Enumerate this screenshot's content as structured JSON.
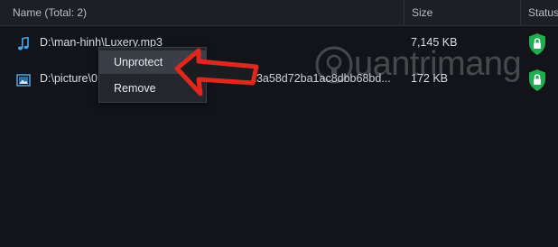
{
  "header": {
    "name_col": "Name (Total: 2)",
    "size_col": "Size",
    "status_col": "Status"
  },
  "files": [
    {
      "name": "D:\\man-hinh\\Luxery.mp3",
      "name_tail": "",
      "size": "7,145 KB",
      "icon": "music-file-icon",
      "status": "protected"
    },
    {
      "name": "D:\\picture\\0",
      "name_tail": "ff6c738c23a58d72ba1ac8dbb68bd...",
      "size": "172 KB",
      "icon": "image-file-icon",
      "status": "protected"
    }
  ],
  "context_menu": {
    "items": [
      "Unprotect",
      "Remove"
    ]
  },
  "watermark": {
    "text": "uantrimang"
  },
  "colors": {
    "status_green": "#1fae4f",
    "accent_red": "#e0271e"
  }
}
